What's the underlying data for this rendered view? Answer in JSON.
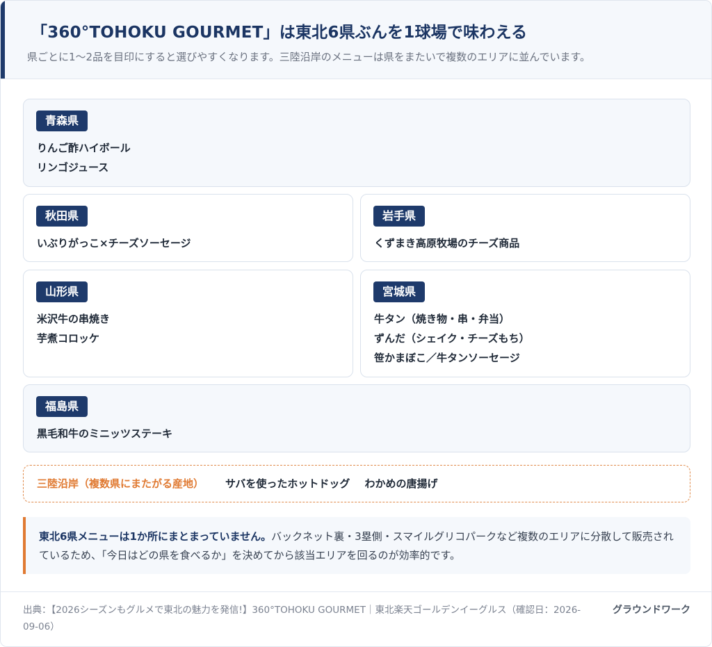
{
  "header": {
    "title": "「360°TOHOKU GOURMET」は東北6県ぶんを1球場で味わえる",
    "subtitle": "県ごとに1〜2品を目印にすると選びやすくなります。三陸沿岸のメニューは県をまたいで複数のエリアに並んでいます。"
  },
  "prefectures": {
    "aomori": {
      "name": "青森県",
      "items": [
        "りんご酢ハイボール",
        "リンゴジュース"
      ]
    },
    "akita": {
      "name": "秋田県",
      "items": [
        "いぶりがっこ×チーズソーセージ"
      ]
    },
    "iwate": {
      "name": "岩手県",
      "items": [
        "くずまき高原牧場のチーズ商品"
      ]
    },
    "yamagata": {
      "name": "山形県",
      "items": [
        "米沢牛の串焼き",
        "芋煮コロッケ"
      ]
    },
    "miyagi": {
      "name": "宮城県",
      "items": [
        "牛タン（焼き物・串・弁当）",
        "ずんだ（シェイク・チーズもち）",
        "笹かまぼこ／牛タンソーセージ"
      ]
    },
    "fukushima": {
      "name": "福島県",
      "items": [
        "黒毛和牛のミニッツステーキ"
      ]
    }
  },
  "sanriku": {
    "label": "三陸沿岸（複数県にまたがる産地）",
    "items": [
      "サバを使ったホットドッグ",
      "わかめの唐揚げ"
    ]
  },
  "note": {
    "lead": "東北6県メニューは1か所にまとまっていません。",
    "body": "バックネット裏・3塁側・スマイルグリコパークなど複数のエリアに分散して販売されているため、「今日はどの県を食べるか」を決めてから該当エリアを回るのが効率的です。"
  },
  "footer": {
    "source": "出典：【2026シーズンもグルメで東北の魅力を発信!】360°TOHOKU GOURMET｜東北楽天ゴールデンイーグルス（確認日：2026-09-06）",
    "brand": "グラウンドワーク"
  },
  "colors": {
    "navy": "#1e3a6b",
    "orange": "#e07a32",
    "panel": "#f5f8fc"
  }
}
